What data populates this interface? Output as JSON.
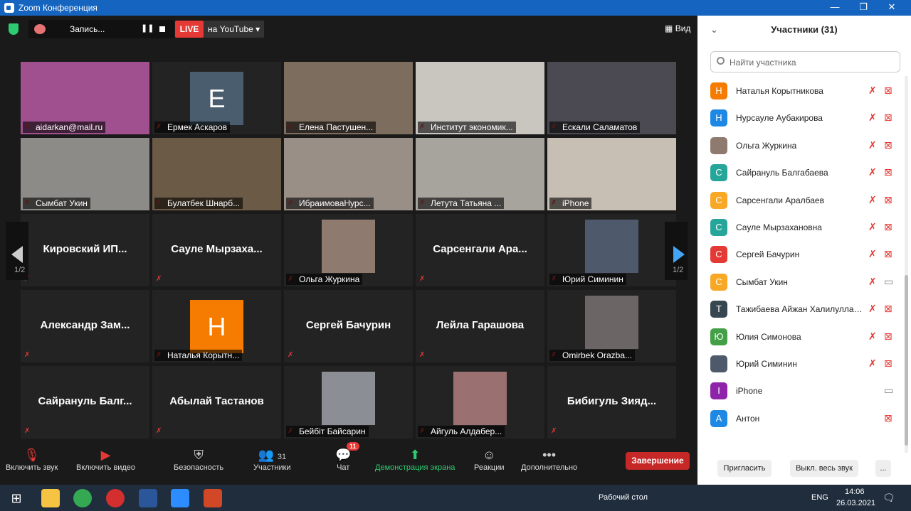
{
  "window": {
    "title": "Zoom Конференция"
  },
  "topbar": {
    "record_label": "Запись...",
    "live": "LIVE",
    "youtube": "на YouTube",
    "view": "Вид"
  },
  "tiles": [
    {
      "name": "aidarkan@mail.ru",
      "photo": "#a0508f"
    },
    {
      "name": "Ермек Аскаров",
      "letter": "E",
      "color": "#4a5d6e"
    },
    {
      "name": "Елена Пастушен...",
      "photo": "#7d6d5e"
    },
    {
      "name": "Институт экономик...",
      "photo": "#c9c6c0",
      "active": true
    },
    {
      "name": "Ескали Саламатов",
      "photo": "#4b4a52"
    },
    {
      "name": "Сымбат Укин",
      "photo": "#8d8b87"
    },
    {
      "name": "Булатбек Шнарб...",
      "photo": "#6b5a45"
    },
    {
      "name": "ИбраимоваНурс...",
      "photo": "#9a8f87"
    },
    {
      "name": "Летута Татьяна ...",
      "photo": "#a7a39d"
    },
    {
      "name": "iPhone",
      "photo": "#c8bfb4"
    },
    {
      "big": "Кировский ИП..."
    },
    {
      "big": "Сауле Мырзаха..."
    },
    {
      "name": "Ольга Журкина",
      "photo": "#8f7a70"
    },
    {
      "big": "Сарсенгали Ара..."
    },
    {
      "name": "Юрий Симинин",
      "photo": "#4e5a6b"
    },
    {
      "big": "Александр Зам..."
    },
    {
      "name": "Наталья Корытн...",
      "letter": "H",
      "color": "#f57c00"
    },
    {
      "big": "Сергей Бачурин"
    },
    {
      "big": "Лейла Гарашова"
    },
    {
      "name": "Omirbek Orazba...",
      "photo": "#6b6565"
    },
    {
      "big": "Сайрануль Балг..."
    },
    {
      "big": "Абылай Тастанов"
    },
    {
      "name": "Бейбіт Байсарин",
      "photo": "#8b8f95"
    },
    {
      "name": "Айгуль Алдабер...",
      "photo": "#9a7070"
    },
    {
      "big": "Бибигуль Зияд..."
    }
  ],
  "nav": {
    "page_left": "1/2",
    "page_right": "1/2"
  },
  "toolbar": {
    "mute": "Включить звук",
    "video": "Включить видео",
    "security": "Безопасность",
    "participants": "Участники",
    "participants_count": "31",
    "chat": "Чат",
    "chat_badge": "11",
    "share": "Демонстрация экрана",
    "reactions": "Реакции",
    "more": "Дополнительно",
    "end": "Завершение"
  },
  "panel": {
    "title": "Участники (31)",
    "search_placeholder": "Найти участника",
    "invite": "Пригласить",
    "mute_all": "Выкл. весь звук",
    "more": "..."
  },
  "participants": [
    {
      "initial": "H",
      "name": "Наталья Корытникова",
      "color": "#f57c00",
      "video": false
    },
    {
      "initial": "H",
      "name": "Нурсауле Аубакирова",
      "color": "#1e88e5",
      "video": false
    },
    {
      "initial": "",
      "name": "Ольга Журкина",
      "color": "#8f7a70",
      "video": false
    },
    {
      "initial": "C",
      "name": "Сайрануль Балгабаева",
      "color": "#26a69a",
      "video": false
    },
    {
      "initial": "C",
      "name": "Сарсенгали Аралбаев",
      "color": "#f9a825",
      "video": false
    },
    {
      "initial": "C",
      "name": "Сауле Мырзахановна",
      "color": "#26a69a",
      "video": false
    },
    {
      "initial": "C",
      "name": "Сергей Бачурин",
      "color": "#e53935",
      "video": false
    },
    {
      "initial": "C",
      "name": "Сымбат Укин",
      "color": "#f9a825",
      "video": true
    },
    {
      "initial": "T",
      "name": "Тажибаева Айжан Халилуллае...",
      "color": "#37474f",
      "video": false
    },
    {
      "initial": "Ю",
      "name": "Юлия Симонова",
      "color": "#43a047",
      "video": false
    },
    {
      "initial": "",
      "name": "Юрий  Симинин",
      "color": "#4e5a6b",
      "video": false
    },
    {
      "initial": "I",
      "name": "iPhone",
      "color": "#8e24aa",
      "video": true,
      "no_mic": true
    },
    {
      "initial": "A",
      "name": "Антон",
      "color": "#1e88e5",
      "video": false,
      "no_mic": true
    }
  ],
  "taskbar": {
    "desktop": "Рабочий стол",
    "lang": "ENG",
    "time": "14:06",
    "date": "26.03.2021"
  }
}
